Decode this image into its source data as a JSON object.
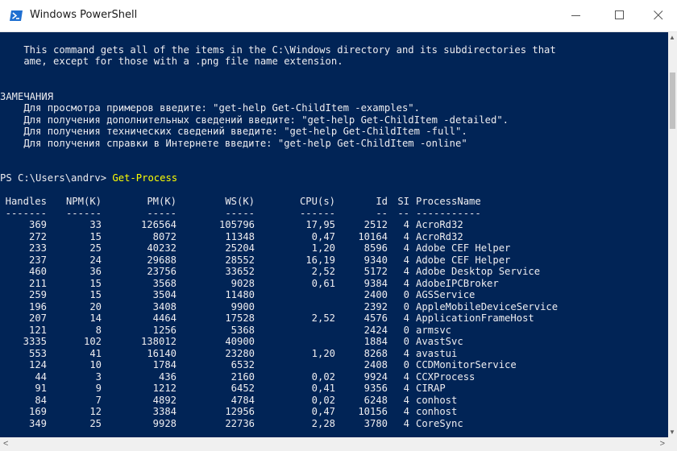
{
  "window": {
    "title": "Windows PowerShell",
    "controls": {
      "minimize": "minimize",
      "maximize": "maximize",
      "close": "close"
    }
  },
  "console": {
    "help_lines": [
      "    This command gets all of the items in the C:\\Windows directory and its subdirectories that",
      "    ame, except for those with a .png file name extension."
    ],
    "remarks_header": "ЗАМЕЧАНИЯ",
    "remarks": [
      "    Для просмотра примеров введите: \"get-help Get-ChildItem -examples\".",
      "    Для получения дополнительных сведений введите: \"get-help Get-ChildItem -detailed\".",
      "    Для получения технических сведений введите: \"get-help Get-ChildItem -full\".",
      "    Для получения справки в Интернете введите: \"get-help Get-ChildItem -online\""
    ],
    "prompt": "PS C:\\Users\\andrv> ",
    "command": "Get-Process",
    "table": {
      "headers": [
        "Handles",
        "NPM(K)",
        "PM(K)",
        "WS(K)",
        "CPU(s)",
        "Id",
        "SI",
        "ProcessName"
      ],
      "separators": [
        "-------",
        "------",
        "-----",
        "-----",
        "------",
        "--",
        "--",
        "-----------"
      ],
      "rows": [
        [
          "369",
          "33",
          "126564",
          "105796",
          "17,95",
          "2512",
          "4",
          "AcroRd32"
        ],
        [
          "272",
          "15",
          "8072",
          "11348",
          "0,47",
          "10164",
          "4",
          "AcroRd32"
        ],
        [
          "233",
          "25",
          "40232",
          "25204",
          "1,20",
          "8596",
          "4",
          "Adobe CEF Helper"
        ],
        [
          "237",
          "24",
          "29688",
          "28552",
          "16,19",
          "9340",
          "4",
          "Adobe CEF Helper"
        ],
        [
          "460",
          "36",
          "23756",
          "33652",
          "2,52",
          "5172",
          "4",
          "Adobe Desktop Service"
        ],
        [
          "211",
          "15",
          "3568",
          "9028",
          "0,61",
          "9384",
          "4",
          "AdobeIPCBroker"
        ],
        [
          "259",
          "15",
          "3504",
          "11480",
          "",
          "2400",
          "0",
          "AGSService"
        ],
        [
          "196",
          "20",
          "3408",
          "9900",
          "",
          "2392",
          "0",
          "AppleMobileDeviceService"
        ],
        [
          "207",
          "14",
          "4464",
          "17528",
          "2,52",
          "4576",
          "4",
          "ApplicationFrameHost"
        ],
        [
          "121",
          "8",
          "1256",
          "5368",
          "",
          "2424",
          "0",
          "armsvc"
        ],
        [
          "3335",
          "102",
          "138012",
          "40900",
          "",
          "1884",
          "0",
          "AvastSvc"
        ],
        [
          "553",
          "41",
          "16140",
          "23280",
          "1,20",
          "8268",
          "4",
          "avastui"
        ],
        [
          "124",
          "10",
          "1784",
          "6532",
          "",
          "2408",
          "0",
          "CCDMonitorService"
        ],
        [
          "44",
          "3",
          "436",
          "2160",
          "0,02",
          "9924",
          "4",
          "CCXProcess"
        ],
        [
          "91",
          "9",
          "1212",
          "6452",
          "0,41",
          "9356",
          "4",
          "CIRAP"
        ],
        [
          "84",
          "7",
          "4892",
          "4784",
          "0,02",
          "6248",
          "4",
          "conhost"
        ],
        [
          "169",
          "12",
          "3384",
          "12956",
          "0,47",
          "10156",
          "4",
          "conhost"
        ],
        [
          "349",
          "25",
          "9928",
          "22736",
          "2,28",
          "3780",
          "4",
          "CoreSync"
        ]
      ]
    }
  },
  "colors": {
    "console_background": "#012456",
    "console_text": "#eeedf0",
    "command_text": "#ffff00",
    "titlebar_background": "#ffffff"
  },
  "icons": {
    "app": "powershell-icon",
    "minimize": "minimize-icon",
    "maximize": "maximize-icon",
    "close": "close-icon",
    "scroll_up": "scroll-up-arrow-icon",
    "scroll_down": "scroll-down-arrow-icon",
    "scroll_left": "scroll-left-arrow-icon",
    "scroll_right": "scroll-right-arrow-icon"
  }
}
